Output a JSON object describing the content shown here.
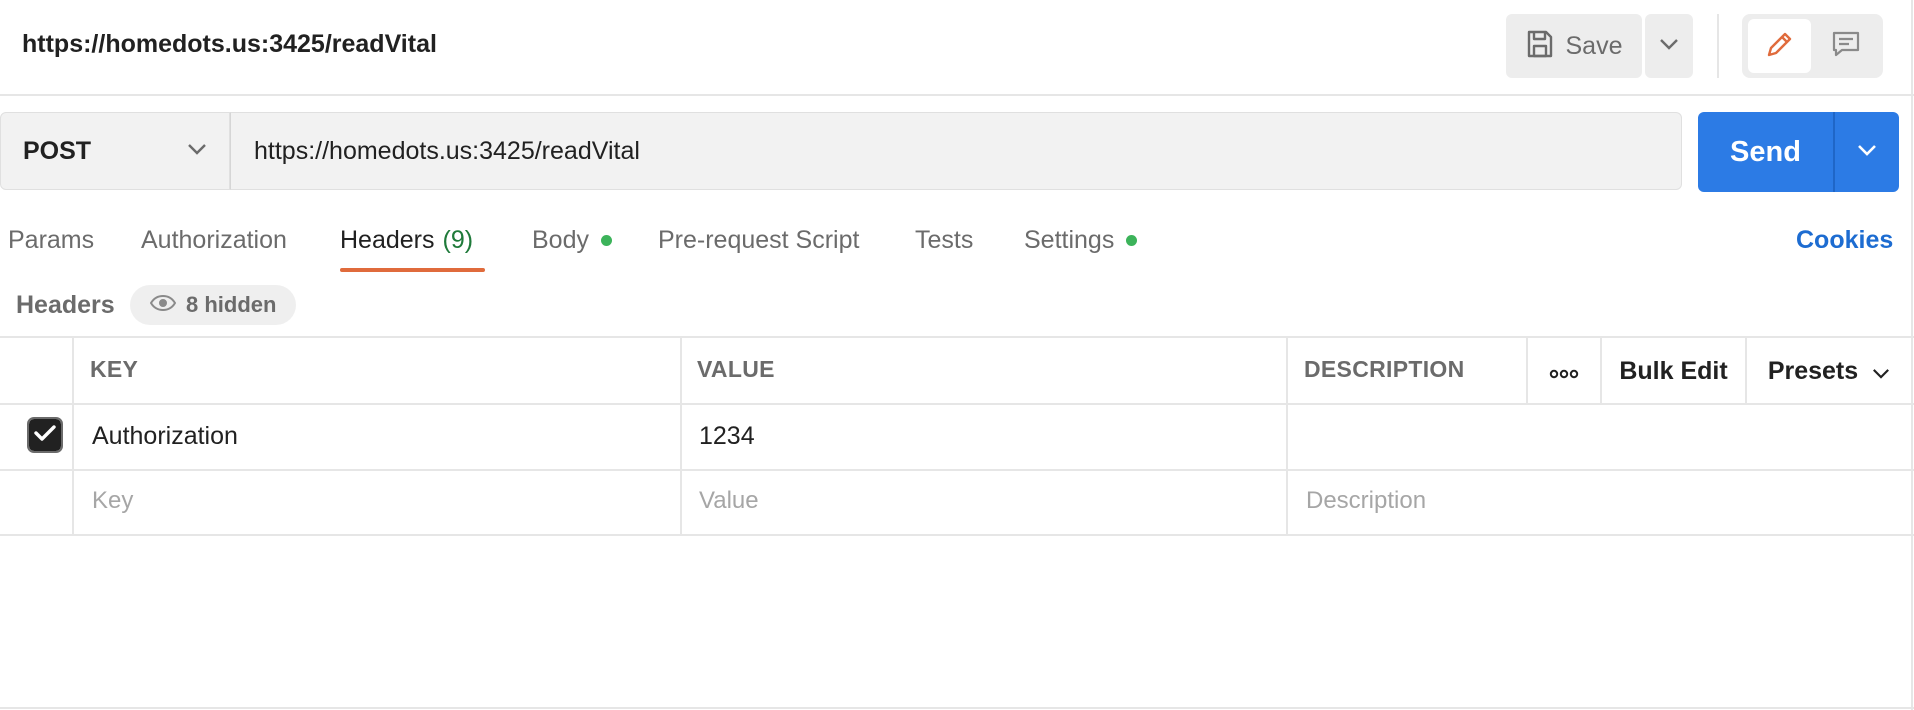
{
  "request": {
    "title": "https://homedots.us:3425/readVital"
  },
  "toolbar": {
    "save_label": "Save",
    "save_icon": "save-icon",
    "dropdown_icon": "chevron-down-icon",
    "edit_icon": "pencil-icon",
    "comment_icon": "comment-icon"
  },
  "urlbar": {
    "method": "POST",
    "url": "https://homedots.us:3425/readVital",
    "send_label": "Send"
  },
  "tabs": [
    {
      "label": "Params"
    },
    {
      "label": "Authorization"
    },
    {
      "label": "Headers",
      "count": "(9)"
    },
    {
      "label": "Body"
    },
    {
      "label": "Pre-request Script"
    },
    {
      "label": "Tests"
    },
    {
      "label": "Settings"
    }
  ],
  "active_tab": "Headers",
  "cookies_label": "Cookies",
  "headers_section": {
    "label": "Headers",
    "hidden_label": "8 hidden"
  },
  "table": {
    "columns": {
      "key": "KEY",
      "value": "VALUE",
      "description": "DESCRIPTION"
    },
    "more_label": "ooo",
    "bulk_edit_label": "Bulk Edit",
    "presets_label": "Presets",
    "rows": [
      {
        "checked": true,
        "key": "Authorization",
        "value": "1234",
        "description": ""
      }
    ],
    "new_row": {
      "key_placeholder": "Key",
      "value_placeholder": "Value",
      "description_placeholder": "Description"
    }
  },
  "colors": {
    "accent": "#2c7be5",
    "active_tab_underline": "#e06b3c",
    "status_dot": "#3cb35a",
    "link": "#1d6cd1"
  }
}
